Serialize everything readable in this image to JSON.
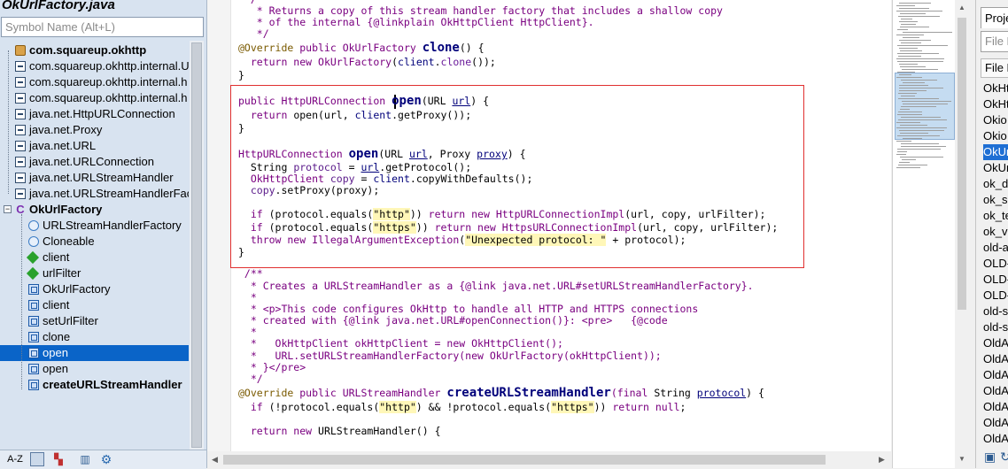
{
  "structure": {
    "title": "OkUrlFactory.java",
    "search_placeholder": "Symbol Name (Alt+L)",
    "tree": [
      {
        "label": "com.squareup.okhttp",
        "icon": "package-icon",
        "bold": true
      },
      {
        "label": "com.squareup.okhttp.internal.U",
        "icon": "import-icon"
      },
      {
        "label": "com.squareup.okhttp.internal.h",
        "icon": "import-icon"
      },
      {
        "label": "com.squareup.okhttp.internal.h",
        "icon": "import-icon"
      },
      {
        "label": "java.net.HttpURLConnection",
        "icon": "import-icon"
      },
      {
        "label": "java.net.Proxy",
        "icon": "import-icon"
      },
      {
        "label": "java.net.URL",
        "icon": "import-icon"
      },
      {
        "label": "java.net.URLConnection",
        "icon": "import-icon"
      },
      {
        "label": "java.net.URLStreamHandler",
        "icon": "import-icon"
      },
      {
        "label": "java.net.URLStreamHandlerFact",
        "icon": "import-icon"
      },
      {
        "label": "OkUrlFactory",
        "icon": "class-icon",
        "bold": true
      },
      {
        "label": "URLStreamHandlerFactory",
        "icon": "interface-icon"
      },
      {
        "label": "Cloneable",
        "icon": "interface-icon"
      },
      {
        "label": "client",
        "icon": "field-icon"
      },
      {
        "label": "urlFilter",
        "icon": "field-icon"
      },
      {
        "label": "OkUrlFactory",
        "icon": "method-icon"
      },
      {
        "label": "client",
        "icon": "method-icon"
      },
      {
        "label": "setUrlFilter",
        "icon": "method-icon"
      },
      {
        "label": "clone",
        "icon": "method-icon"
      },
      {
        "label": "open",
        "icon": "method-icon",
        "selected": true
      },
      {
        "label": "open",
        "icon": "method-icon"
      },
      {
        "label": "createURLStreamHandler",
        "icon": "method-icon",
        "bold": true
      }
    ],
    "toolbar": {
      "sort_label": "A-Z"
    }
  },
  "editor": {
    "lines": {
      "l0": "  /**",
      "l1a": "   * Returns a copy of this stream handler factory that includes a shallow copy",
      "l2a": "   * of the internal {@linkplain OkHttpClient HttpClient}.",
      "l3a": "   */",
      "l4_ann": "@Override",
      "l4_kw": " public ",
      "l4_tp": "OkUrlFactory ",
      "l4_fn": "clone",
      "l4_rest": "() {",
      "l5_kw": "  return new ",
      "l5_tp": "OkUrlFactory",
      "l5_a": "(",
      "l5_fd": "client",
      "l5_b": ".",
      "l5_c": "clone",
      "l5_d": "());",
      "l6": "}",
      "m1_kw": "public ",
      "m1_tp": "HttpURLConnection ",
      "m1_fn": "open",
      "m1_a": "(URL ",
      "m1_p": "url",
      "m1_b": ") {",
      "m2_kw": "  return ",
      "m2_a": "open(url, ",
      "m2_fd": "client",
      "m2_b": ".getProxy());",
      "m3": "}",
      "n1_tp": "HttpURLConnection ",
      "n1_fn": "open",
      "n1_a": "(URL ",
      "n1_p1": "url",
      "n1_b": ", Proxy ",
      "n1_p2": "proxy",
      "n1_c": ") {",
      "n2_a": "  String ",
      "n2_lv": "protocol",
      "n2_b": " = ",
      "n2_p": "url",
      "n2_c": ".getProtocol();",
      "n3_tp": "  OkHttpClient ",
      "n3_lv": "copy",
      "n3_b": " = ",
      "n3_fd": "client",
      "n3_c": ".copyWithDefaults();",
      "n4_lv": "  copy",
      "n4_b": ".setProxy(proxy);",
      "n6_kw": "  if ",
      "n6_a": "(protocol.equals(",
      "n6_st": "\"http\"",
      "n6_b": ")) ",
      "n6_kw2": "return new ",
      "n6_tp": "HttpURLConnectionImpl",
      "n6_c": "(url, copy, urlFilter);",
      "n7_kw": "  if ",
      "n7_a": "(protocol.equals(",
      "n7_st": "\"https\"",
      "n7_b": ")) ",
      "n7_kw2": "return new ",
      "n7_tp": "HttpsURLConnectionImpl",
      "n7_c": "(url, copy, urlFilter);",
      "n8_kw": "  throw new ",
      "n8_tp": "IllegalArgumentException",
      "n8_a": "(",
      "n8_st": "\"Unexpected protocol: \"",
      "n8_b": " + protocol);",
      "n9": "}",
      "c1": " /**",
      "c2": "  * Creates a URLStreamHandler as a {@link java.net.URL#setURLStreamHandlerFactory}.",
      "c3": "  *",
      "c4": "  * <p>This code configures OkHttp to handle all HTTP and HTTPS connections",
      "c5": "  * created with {@link java.net.URL#openConnection()}: <pre>   {@code",
      "c6": "  *",
      "c7": "  *   OkHttpClient okHttpClient = new OkHttpClient();",
      "c8": "  *   URL.setURLStreamHandlerFactory(new OkUrlFactory(okHttpClient));",
      "c9": "  * }</pre>",
      "c10": "  */",
      "k1_ann": "@Override",
      "k1_kw": " public ",
      "k1_tp": "URLStreamHandler ",
      "k1_fn": "createURLStreamHandler",
      "k1_a": "(final ",
      "k1_b": "String ",
      "k1_p": "protocol",
      "k1_c": ") {",
      "k2_kw": "  if ",
      "k2_a": "(!protocol.equals(",
      "k2_st1": "\"http\"",
      "k2_b": ") && !protocol.equals(",
      "k2_st2": "\"https\"",
      "k2_c": ")) ",
      "k2_kw2": "return null",
      "k2_d": ";",
      "k3_kw": "  return new ",
      "k3_a": "URLStreamHandler() {"
    }
  },
  "project": {
    "tab_label": "Project",
    "search_placeholder": "File Name",
    "column_header": "File Name",
    "files": [
      "OkHt",
      "OkHt",
      "Okio",
      "Okio",
      "OkUr",
      "OkUr",
      "ok_d",
      "ok_su",
      "ok_te",
      "ok_vi",
      "old-a",
      "OLD-",
      "OLD-",
      "OLD-",
      "old-s",
      "old-s",
      "OldA",
      "OldA",
      "OldA",
      "OldA",
      "OldA",
      "OldA",
      "OldA"
    ],
    "selected_index": 4
  },
  "colors": {
    "selection": "#0a64c8",
    "highlight_box": "#e03030",
    "keyword": "#7a0080"
  }
}
